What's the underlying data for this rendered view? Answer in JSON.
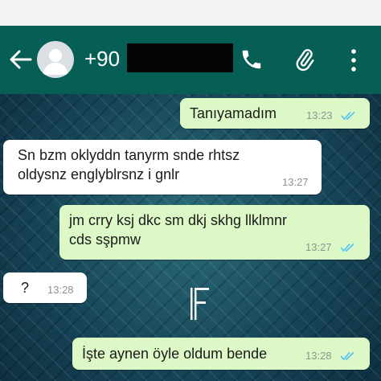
{
  "header": {
    "contact_name": "+90",
    "back_icon": "arrow-left-icon",
    "call_icon": "phone-icon",
    "attach_icon": "paperclip-icon",
    "menu_icon": "more-vert-icon"
  },
  "colors": {
    "header": "#075e54",
    "outgoing_bubble": "#dcf8c6",
    "incoming_bubble": "#ffffff",
    "read_ticks": "#4fc3f7"
  },
  "messages": [
    {
      "direction": "outgoing",
      "text": "Tanıyamadım",
      "time": "13:23",
      "status": "read"
    },
    {
      "direction": "incoming",
      "lines": [
        "Sn bzm oklyddn tanyrm snde rhtsz",
        "oldysnz englyblrsnz i gnlr"
      ],
      "time": "13:27"
    },
    {
      "direction": "outgoing",
      "lines": [
        "jm crry ksj dkc sm dkj skhg llklmnr",
        "cds sşpmw"
      ],
      "time": "13:27",
      "status": "read"
    },
    {
      "direction": "incoming",
      "text": "?",
      "time": "13:28"
    },
    {
      "direction": "outgoing",
      "text": "İşte aynen öyle oldum bende",
      "time": "13:28",
      "status": "read"
    }
  ],
  "watermark_logo": "F"
}
